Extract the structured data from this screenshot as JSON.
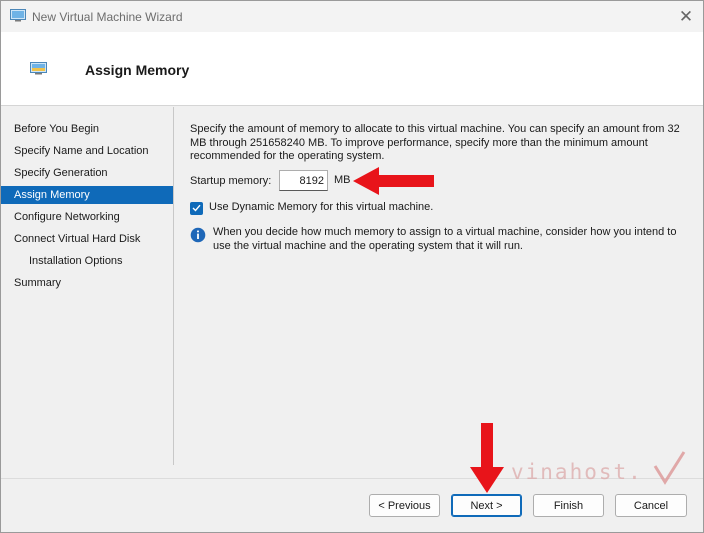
{
  "window": {
    "title": "New Virtual Machine Wizard"
  },
  "header": {
    "title": "Assign Memory"
  },
  "sidebar": {
    "items": [
      {
        "label": "Before You Begin"
      },
      {
        "label": "Specify Name and Location"
      },
      {
        "label": "Specify Generation"
      },
      {
        "label": "Assign Memory",
        "active": true
      },
      {
        "label": "Configure Networking"
      },
      {
        "label": "Connect Virtual Hard Disk"
      },
      {
        "label": "Installation Options"
      },
      {
        "label": "Summary"
      }
    ]
  },
  "main": {
    "description": "Specify the amount of memory to allocate to this virtual machine. You can specify an amount from 32 MB through 251658240 MB. To improve performance, specify more than the minimum amount recommended for the operating system.",
    "startup_label": "Startup memory:",
    "startup_value": "8192",
    "startup_unit": "MB",
    "dynamic_memory_label": "Use Dynamic Memory for this virtual machine.",
    "dynamic_memory_checked": true,
    "info_text": "When you decide how much memory to assign to a virtual machine, consider how you intend to use the virtual machine and the operating system that it will run."
  },
  "buttons": {
    "previous": "< Previous",
    "next": "Next >",
    "finish": "Finish",
    "cancel": "Cancel"
  },
  "watermark": "vinahost.",
  "colors": {
    "accent": "#0f6ab9",
    "annotation_arrow": "#e8141a"
  },
  "icons": {
    "title": "vm-monitor-icon",
    "header": "vm-monitor-icon",
    "close": "close-icon",
    "info": "info-icon"
  }
}
